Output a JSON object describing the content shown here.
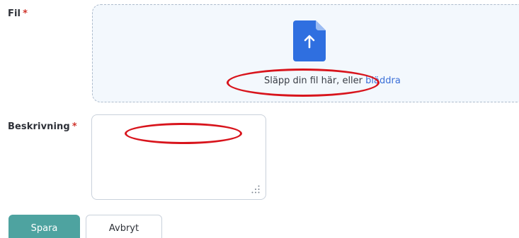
{
  "form": {
    "file_label": "Fil",
    "description_label": "Beskrivning",
    "required_mark": "*"
  },
  "dropzone": {
    "prompt_text": "Släpp din fil här, eller ",
    "browse_link": "bläddra",
    "icon": "file-upload-icon"
  },
  "description": {
    "value": ""
  },
  "buttons": {
    "save_label": "Spara",
    "cancel_label": "Avbryt"
  },
  "annotations": {
    "highlight_color": "#d8141c"
  },
  "colors": {
    "accent": "#4ea3a0",
    "link": "#3b6fd8",
    "icon_blue": "#2f6fe0",
    "required": "#d0342c"
  }
}
